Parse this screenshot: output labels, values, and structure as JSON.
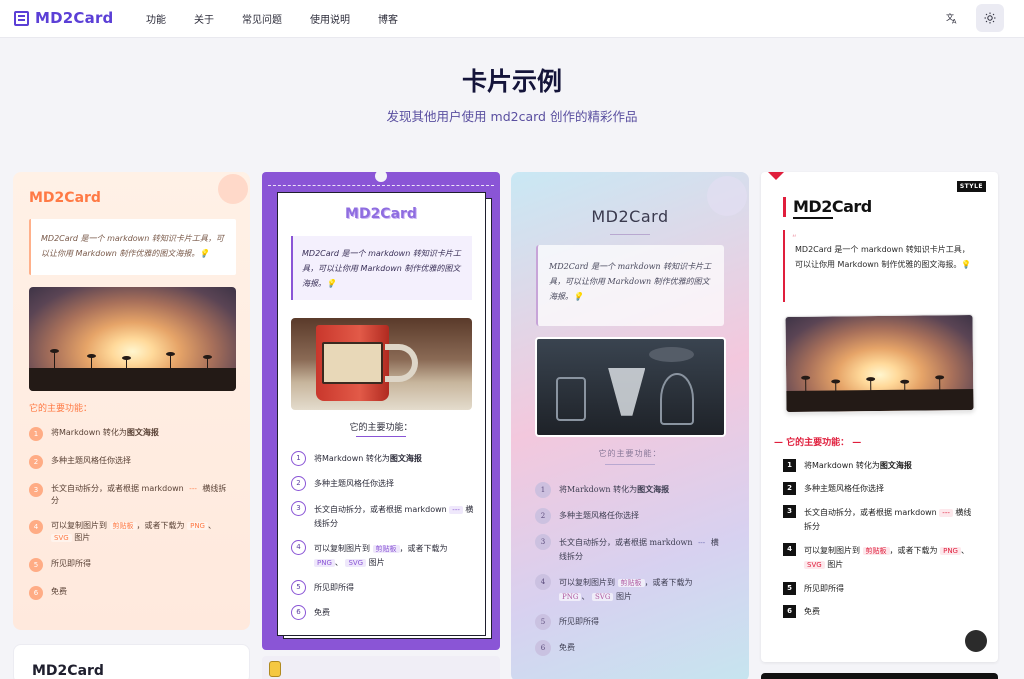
{
  "nav": {
    "logo": "MD2Card",
    "items": [
      "功能",
      "关于",
      "常见问题",
      "使用说明",
      "博客"
    ],
    "lang_icon": "translate-icon",
    "theme_icon": "sun-icon"
  },
  "hero": {
    "title": "卡片示例",
    "subtitle": "发现其他用户使用 md2card 创作的精彩作品"
  },
  "cards": [
    {
      "title": "MD2Card",
      "quote": "MD2Card 是一个 markdown 转知识卡片工具，可以让你用 Markdown 制作优雅的图文海报。💡",
      "subtitle": "它的主要功能：",
      "features": [
        {
          "num": "1",
          "text": "将Markdown 转化为",
          "strong": "图文海报"
        },
        {
          "num": "2",
          "text": "多种主题风格任你选择"
        },
        {
          "num": "3",
          "text": "长文自动拆分，或者根据 markdown",
          "tag": "---",
          "tail": "横线拆分"
        },
        {
          "num": "4",
          "text": "可以复制图片到",
          "tag": "剪贴板",
          "mid": "，或者下载为",
          "tag2": "PNG",
          "sep": "、",
          "tag3": "SVG",
          "tail": "图片"
        },
        {
          "num": "5",
          "text": "所见即所得"
        },
        {
          "num": "6",
          "text": "免费"
        }
      ]
    },
    {
      "title": "MD2Card",
      "quote": "MD2Card 是一个 markdown 转知识卡片工具，可以让你用 Markdown 制作优雅的图文海报。💡",
      "subtitle": "它的主要功能：",
      "features": [
        {
          "num": "1",
          "text": "将Markdown 转化为",
          "strong": "图文海报"
        },
        {
          "num": "2",
          "text": "多种主题风格任你选择"
        },
        {
          "num": "3",
          "text": "长文自动拆分，或者根据 markdown",
          "tag": "---",
          "tail": "横线拆分"
        },
        {
          "num": "4",
          "text": "可以复制图片到",
          "tag": "剪贴板",
          "mid": "，或者下载为",
          "tag2": "PNG",
          "sep": "、",
          "tag3": "SVG",
          "tail": "图片"
        },
        {
          "num": "5",
          "text": "所见即所得"
        },
        {
          "num": "6",
          "text": "免费"
        }
      ]
    },
    {
      "title": "MD2Card",
      "quote": "MD2Card 是一个 markdown 转知识卡片工具，可以让你用 Markdown 制作优雅的图文海报。💡",
      "subtitle": "它的主要功能：",
      "features": [
        {
          "num": "1",
          "text": "将Markdown 转化为",
          "strong": "图文海报"
        },
        {
          "num": "2",
          "text": "多种主题风格任你选择"
        },
        {
          "num": "3",
          "text": "长文自动拆分，或者根据 markdown",
          "tag": "---",
          "tail": "横线拆分"
        },
        {
          "num": "4",
          "text": "可以复制图片到",
          "tag": "剪贴板",
          "mid": "，或者下载为",
          "tag2": "PNG",
          "sep": "、",
          "tag3": "SVG",
          "tail": "图片"
        },
        {
          "num": "5",
          "text": "所见即所得"
        },
        {
          "num": "6",
          "text": "免费"
        }
      ]
    },
    {
      "title": "MD2Card",
      "badge": "STYLE",
      "quote_mark": "“",
      "quote": "MD2Card 是一个 markdown 转知识卡片工具，可以让你用 Markdown 制作优雅的图文海报。💡",
      "subtitle": "它的主要功能：",
      "features": [
        {
          "num": "1",
          "text": "将Markdown 转化为",
          "strong": "图文海报"
        },
        {
          "num": "2",
          "text": "多种主题风格任你选择"
        },
        {
          "num": "3",
          "text": "长文自动拆分，或者根据 markdown",
          "tag": "---",
          "tail": "横线拆分"
        },
        {
          "num": "4",
          "text": "可以复制图片到",
          "tag": "剪贴板",
          "mid": "，或者下载为",
          "tag2": "PNG",
          "sep": "、",
          "tag3": "SVG",
          "tail": "图片"
        },
        {
          "num": "5",
          "text": "所见即所得"
        },
        {
          "num": "6",
          "text": "免费"
        }
      ]
    },
    {
      "title": "MD2Card"
    }
  ],
  "colors": {
    "brand": "#5b3fd6",
    "card1_accent": "#ff7a45",
    "card2_bg": "#8a55d6",
    "card4_accent": "#e01e3c"
  }
}
